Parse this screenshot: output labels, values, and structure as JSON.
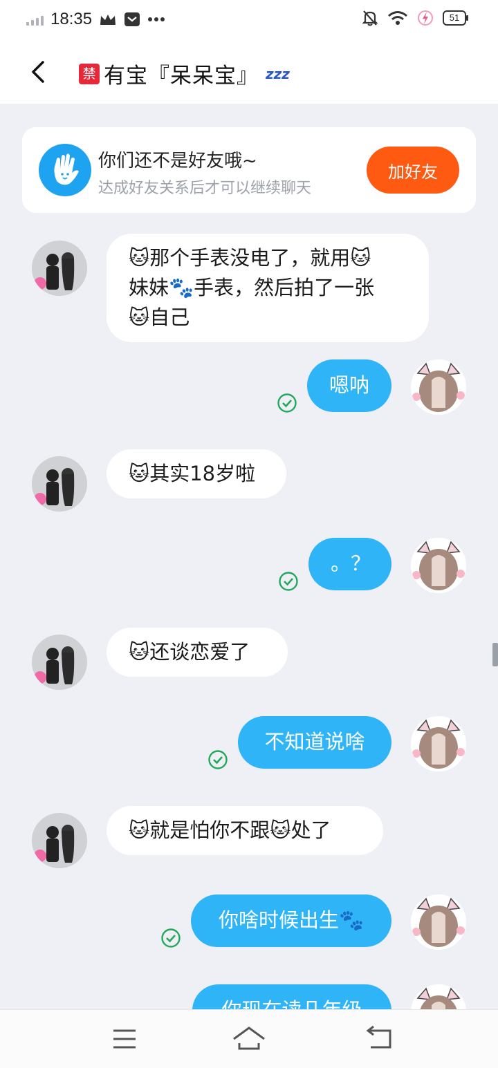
{
  "status_bar": {
    "time": "18:35",
    "battery": "51",
    "icons": [
      "signal-icon",
      "crown-icon",
      "message-box-icon",
      "more-dots-icon",
      "mute-bell-icon",
      "wifi-icon",
      "flash-icon",
      "battery-icon"
    ]
  },
  "header": {
    "badge": "禁",
    "title": "有宝『呆呆宝』",
    "sleep_icon": "zzz"
  },
  "friend_prompt": {
    "title": "你们还不是好友哦~",
    "subtitle": "达成好友关系后才可以继续聊天",
    "button": "加好友"
  },
  "messages": [
    {
      "side": "left",
      "text": "🐱那个手表没电了，就用🐱\n妹妹🐾手表，然后拍了一张\n🐱自己"
    },
    {
      "side": "right",
      "text": "嗯呐",
      "status": "read"
    },
    {
      "side": "left",
      "text": "🐱其实18岁啦"
    },
    {
      "side": "right",
      "text": "。？",
      "status": "read"
    },
    {
      "side": "left",
      "text": "🐱还谈恋爱了"
    },
    {
      "side": "right",
      "text": "不知道说啥",
      "status": "read"
    },
    {
      "side": "left",
      "text": "🐱就是怕你不跟🐱处了"
    },
    {
      "side": "right",
      "text": "你啥时候出生🐾",
      "status": "read"
    },
    {
      "side": "right",
      "text": "你现在读几年级",
      "status": "sent"
    }
  ],
  "nav_bar": {
    "buttons": [
      "menu-icon",
      "home-icon",
      "back-nav-icon"
    ]
  },
  "colors": {
    "outgoing_bubble": "#2fb5f7",
    "incoming_bubble": "#ffffff",
    "add_friend_button": "#ff5a12",
    "read_check": "#22a85a",
    "background": "#eef0f5"
  }
}
